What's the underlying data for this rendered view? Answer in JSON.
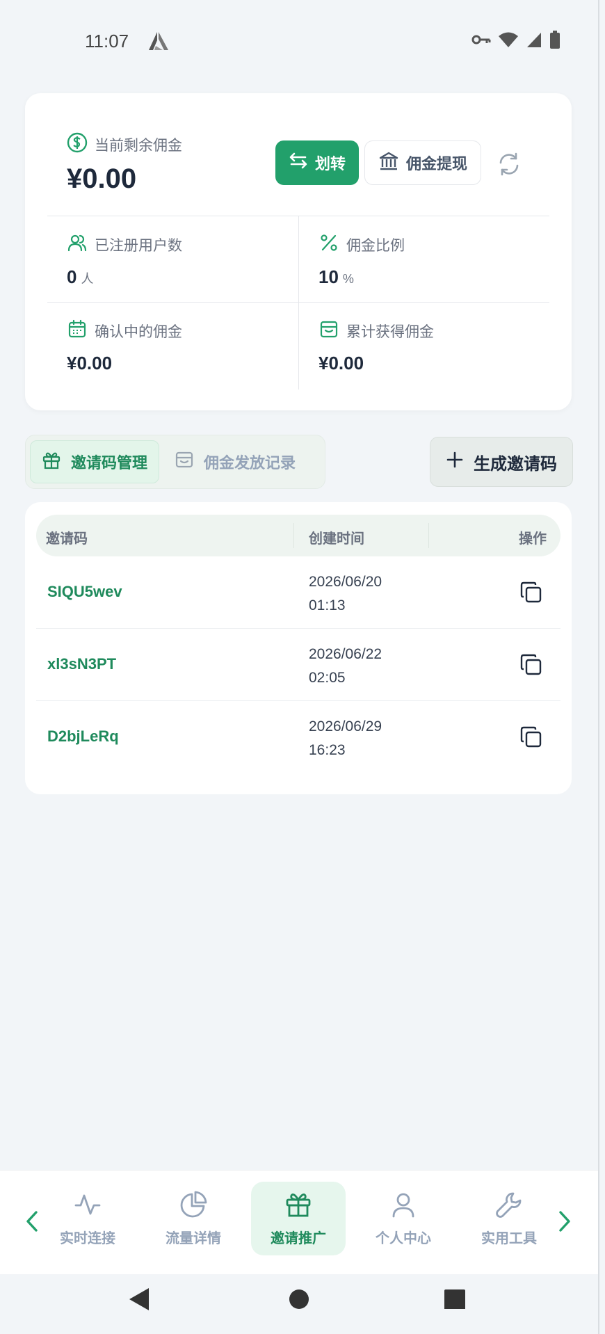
{
  "status_bar": {
    "time": "11:07"
  },
  "balance": {
    "label": "当前剩余佣金",
    "value": "¥0.00"
  },
  "actions": {
    "transfer": "划转",
    "withdraw": "佣金提现"
  },
  "stats": {
    "registered": {
      "label": "已注册用户数",
      "value": "0",
      "unit": "人"
    },
    "rate": {
      "label": "佣金比例",
      "value": "10",
      "unit": "%"
    },
    "pending": {
      "label": "确认中的佣金",
      "value": "¥0.00"
    },
    "total": {
      "label": "累计获得佣金",
      "value": "¥0.00"
    }
  },
  "tabs": [
    {
      "label": "邀请码管理",
      "active": true
    },
    {
      "label": "佣金发放记录",
      "active": false
    }
  ],
  "generate_label": "生成邀请码",
  "table": {
    "headers": [
      "邀请码",
      "创建时间",
      "操作"
    ],
    "rows": [
      {
        "code": "SIQU5wev",
        "date": "2026/06/20",
        "time": "01:13"
      },
      {
        "code": "xl3sN3PT",
        "date": "2026/06/22",
        "time": "02:05"
      },
      {
        "code": "D2bjLeRq",
        "date": "2026/06/29",
        "time": "16:23"
      }
    ]
  },
  "nav": [
    {
      "label": "实时连接",
      "icon": "activity-icon",
      "active": false
    },
    {
      "label": "流量详情",
      "icon": "pie-chart-icon",
      "active": false
    },
    {
      "label": "邀请推广",
      "icon": "gift-icon",
      "active": true
    },
    {
      "label": "个人中心",
      "icon": "user-icon",
      "active": false
    },
    {
      "label": "实用工具",
      "icon": "wrench-icon",
      "active": false
    }
  ],
  "colors": {
    "accent": "#22a06b",
    "accent_text": "#1f8a5c",
    "background": "#f2f5f8"
  }
}
